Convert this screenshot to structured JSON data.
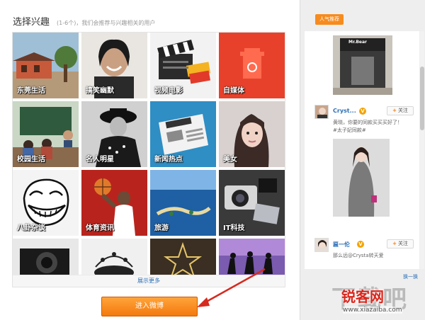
{
  "header": {
    "title": "选择兴趣",
    "subtitle": "(1-6个)，我们会推荐与兴趣相关的用户"
  },
  "interests": [
    {
      "label": "东莞生活",
      "icon": "village-photo"
    },
    {
      "label": "搞笑幽默",
      "icon": "comedian-photo"
    },
    {
      "label": "视频电影",
      "icon": "clapperboard-icon"
    },
    {
      "label": "自媒体",
      "icon": "trash-can-icon"
    },
    {
      "label": "校园生活",
      "icon": "classroom-photo"
    },
    {
      "label": "名人明星",
      "icon": "celebrity-photo"
    },
    {
      "label": "新闻热点",
      "icon": "newspaper-icon"
    },
    {
      "label": "美女",
      "icon": "girl-photo"
    },
    {
      "label": "八卦杂谈",
      "icon": "trollface-icon"
    },
    {
      "label": "体育资讯",
      "icon": "basketball-photo"
    },
    {
      "label": "旅游",
      "icon": "island-photo"
    },
    {
      "label": "IT科技",
      "icon": "camera-gadgets-photo"
    },
    {
      "label": "",
      "icon": "vintage-camera-photo"
    },
    {
      "label": "",
      "icon": "music-notes-photo"
    },
    {
      "label": "",
      "icon": "stage-lights-photo"
    },
    {
      "label": "",
      "icon": "dancers-silhouette-photo"
    }
  ],
  "show_more": "展示更多",
  "enter_button": "进入微博",
  "sidebar": {
    "tag": "人气推荐",
    "posts": [
      {
        "user": "Cryst...",
        "verified": "V",
        "follow": "关注",
        "text1": "黄晓，你要的同款买买买好了！",
        "text2": "#太子妃同款#"
      },
      {
        "user": "匾一伦",
        "verified": "V",
        "follow": "关注",
        "text1": "那么远@Crysta转天爱"
      }
    ],
    "swap": "换一换",
    "shop_sign": "Mr.Bear"
  },
  "watermark": {
    "big": "下载吧",
    "red": "锐客网",
    "url": "www.xiazaiba.com"
  },
  "colors": {
    "accent_orange": "#f37a0e",
    "link_blue": "#2c6fb6"
  }
}
